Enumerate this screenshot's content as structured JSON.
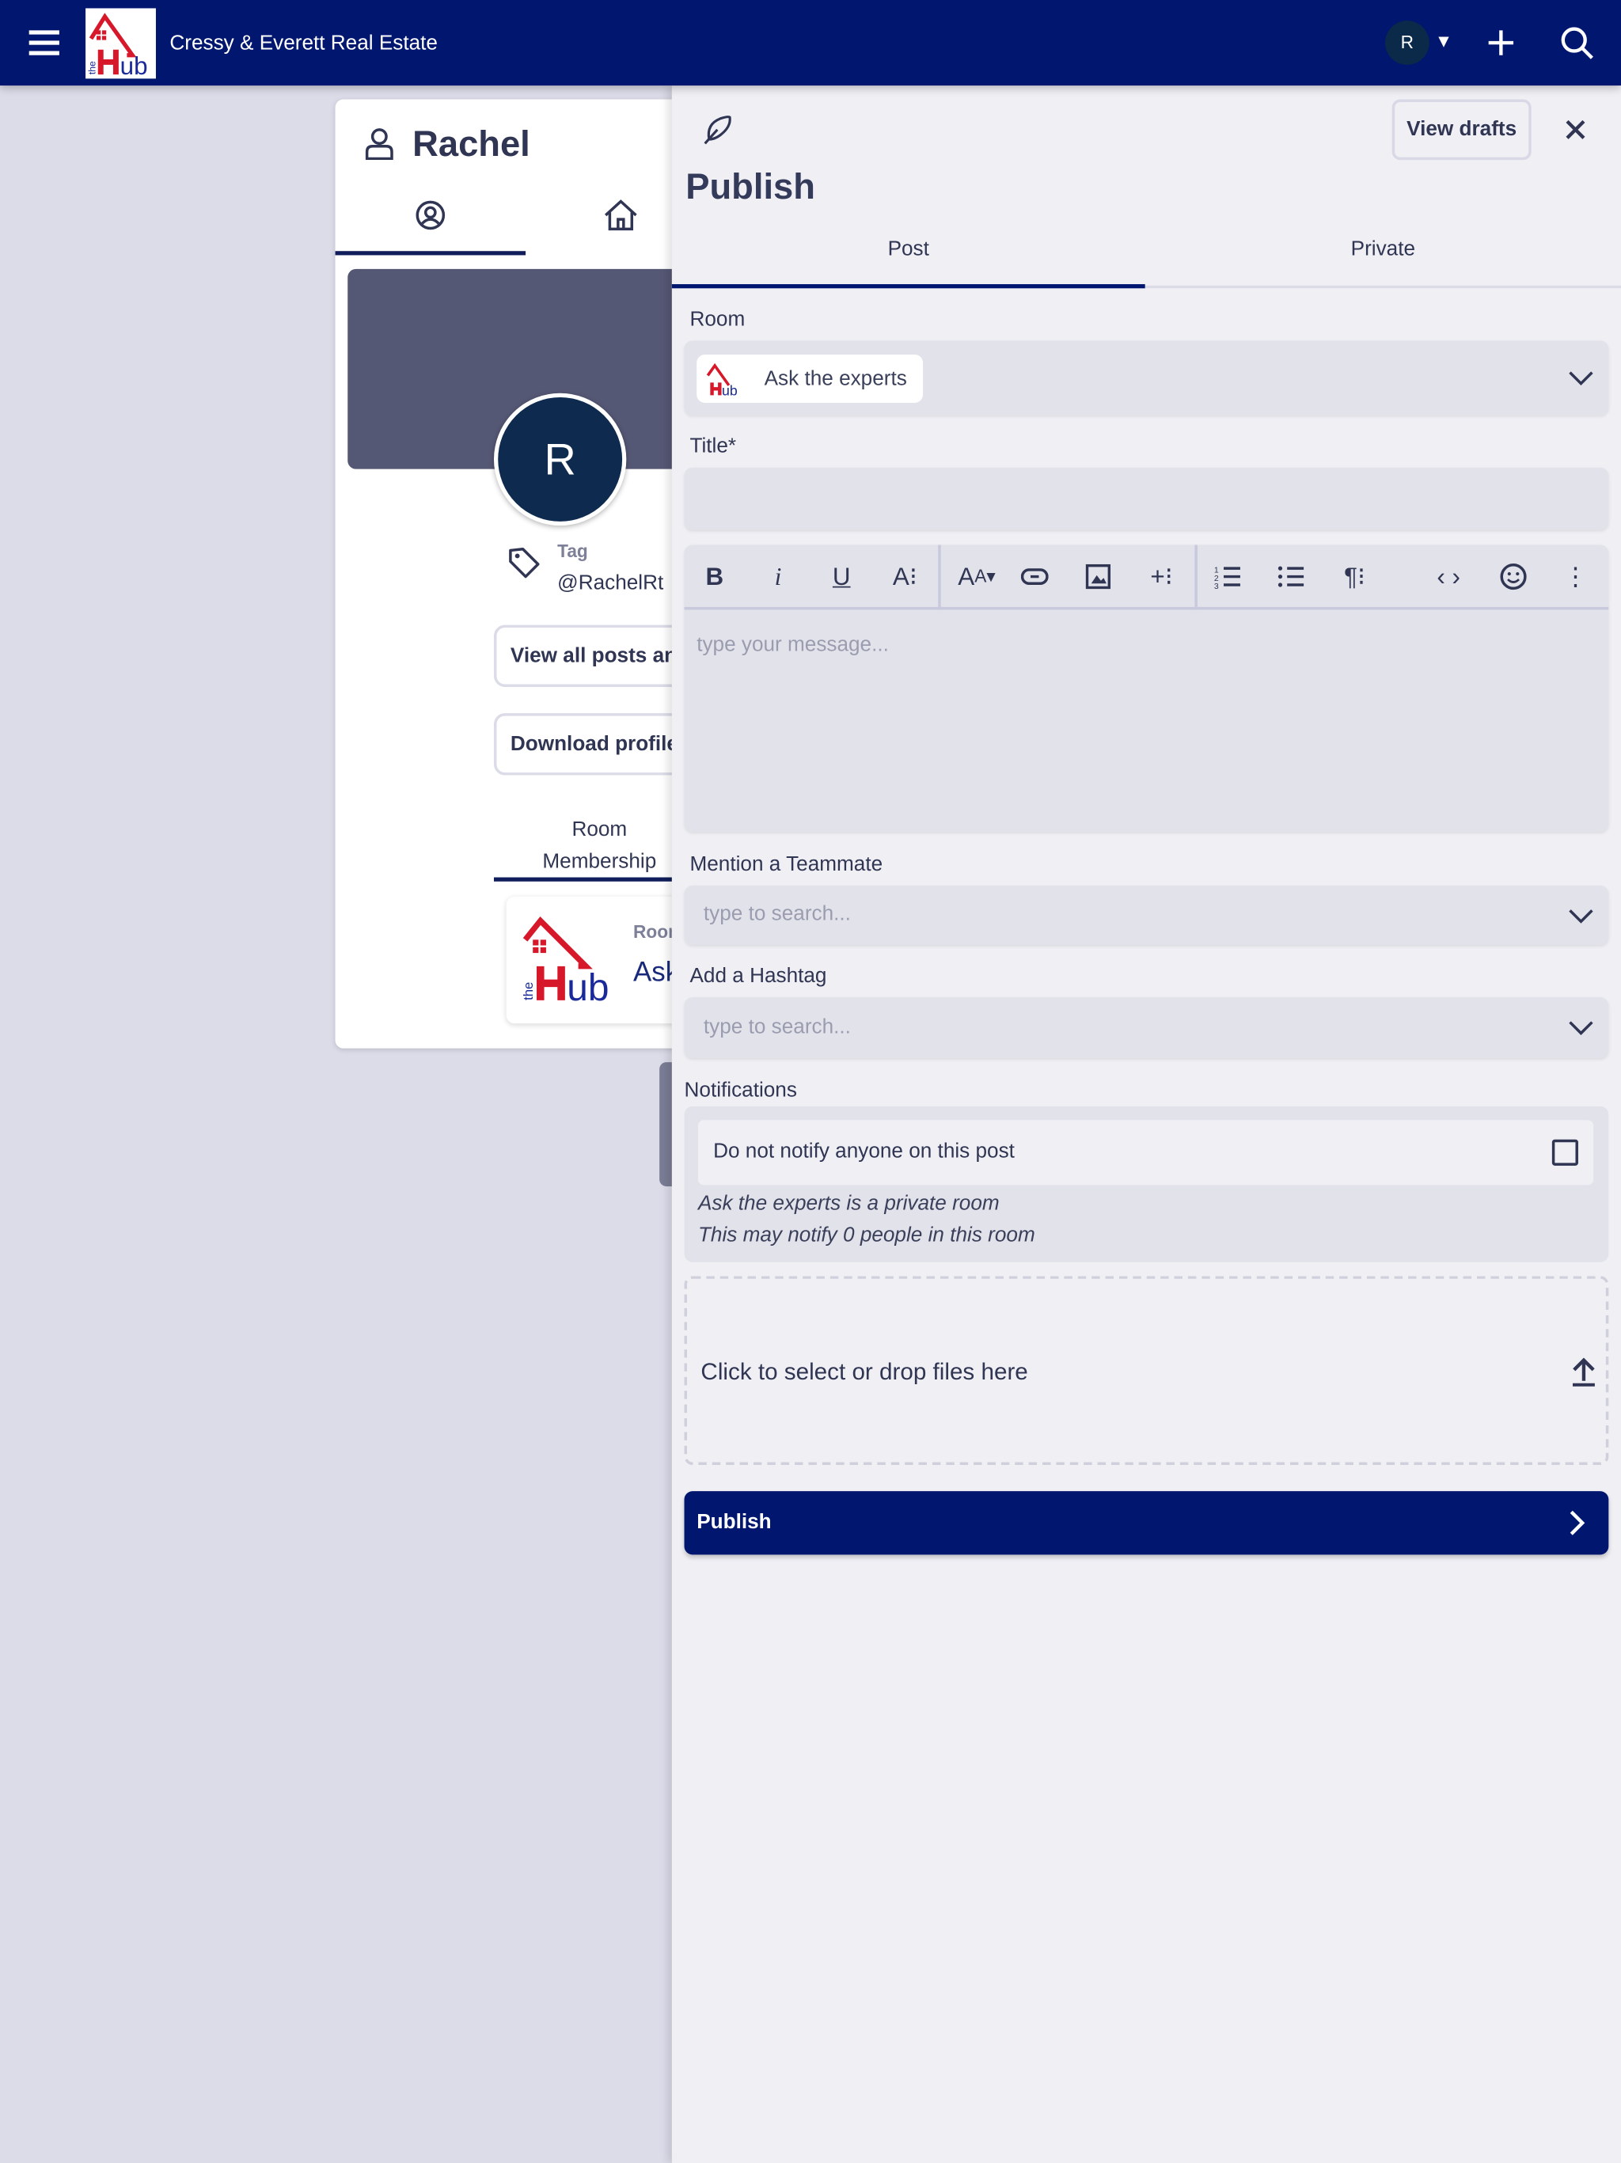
{
  "header": {
    "company_name": "Cressy & Everett Real Estate",
    "avatar_initial": "R",
    "logo_text": "theHub"
  },
  "profile": {
    "name": "Rachel",
    "avatar_initial": "R",
    "tag_label": "Tag",
    "tag_value": "@RachelRt",
    "view_posts_button": "View all posts an",
    "download_button": "Download profile",
    "room_membership_tab": [
      "Room",
      "Membership"
    ],
    "room_card": {
      "label": "Room",
      "name": "Ask"
    }
  },
  "publish": {
    "title": "Publish",
    "view_drafts": "View drafts",
    "tabs": [
      {
        "label": "Post",
        "active": true
      },
      {
        "label": "Private",
        "active": false
      }
    ],
    "room_label": "Room",
    "room_value": "Ask the experts",
    "title_label": "Title*",
    "title_value": "",
    "editor_placeholder": "type your message...",
    "toolbar": [
      "bold-icon",
      "italic-icon",
      "underline-icon",
      "text-style-icon",
      "font-size-icon",
      "link-icon",
      "image-icon",
      "insert-icon",
      "ordered-list-icon",
      "bullet-list-icon",
      "paragraph-icon",
      "code-icon",
      "emoji-icon",
      "more-icon"
    ],
    "mention_label": "Mention a Teammate",
    "mention_placeholder": "type to search...",
    "hashtag_label": "Add a Hashtag",
    "hashtag_placeholder": "type to search...",
    "notifications_label": "Notifications",
    "no_notify_label": "Do not notify anyone on this post",
    "no_notify_checked": false,
    "notify_info_1": "Ask the experts is a private room",
    "notify_info_2": "This may notify 0 people in this room",
    "dropzone_text": "Click to select or drop files here",
    "submit_label": "Publish"
  },
  "colors": {
    "primary": "#00166f",
    "background": "#dcdce9",
    "panel": "#efeff4",
    "logo_red": "#d7182a"
  }
}
